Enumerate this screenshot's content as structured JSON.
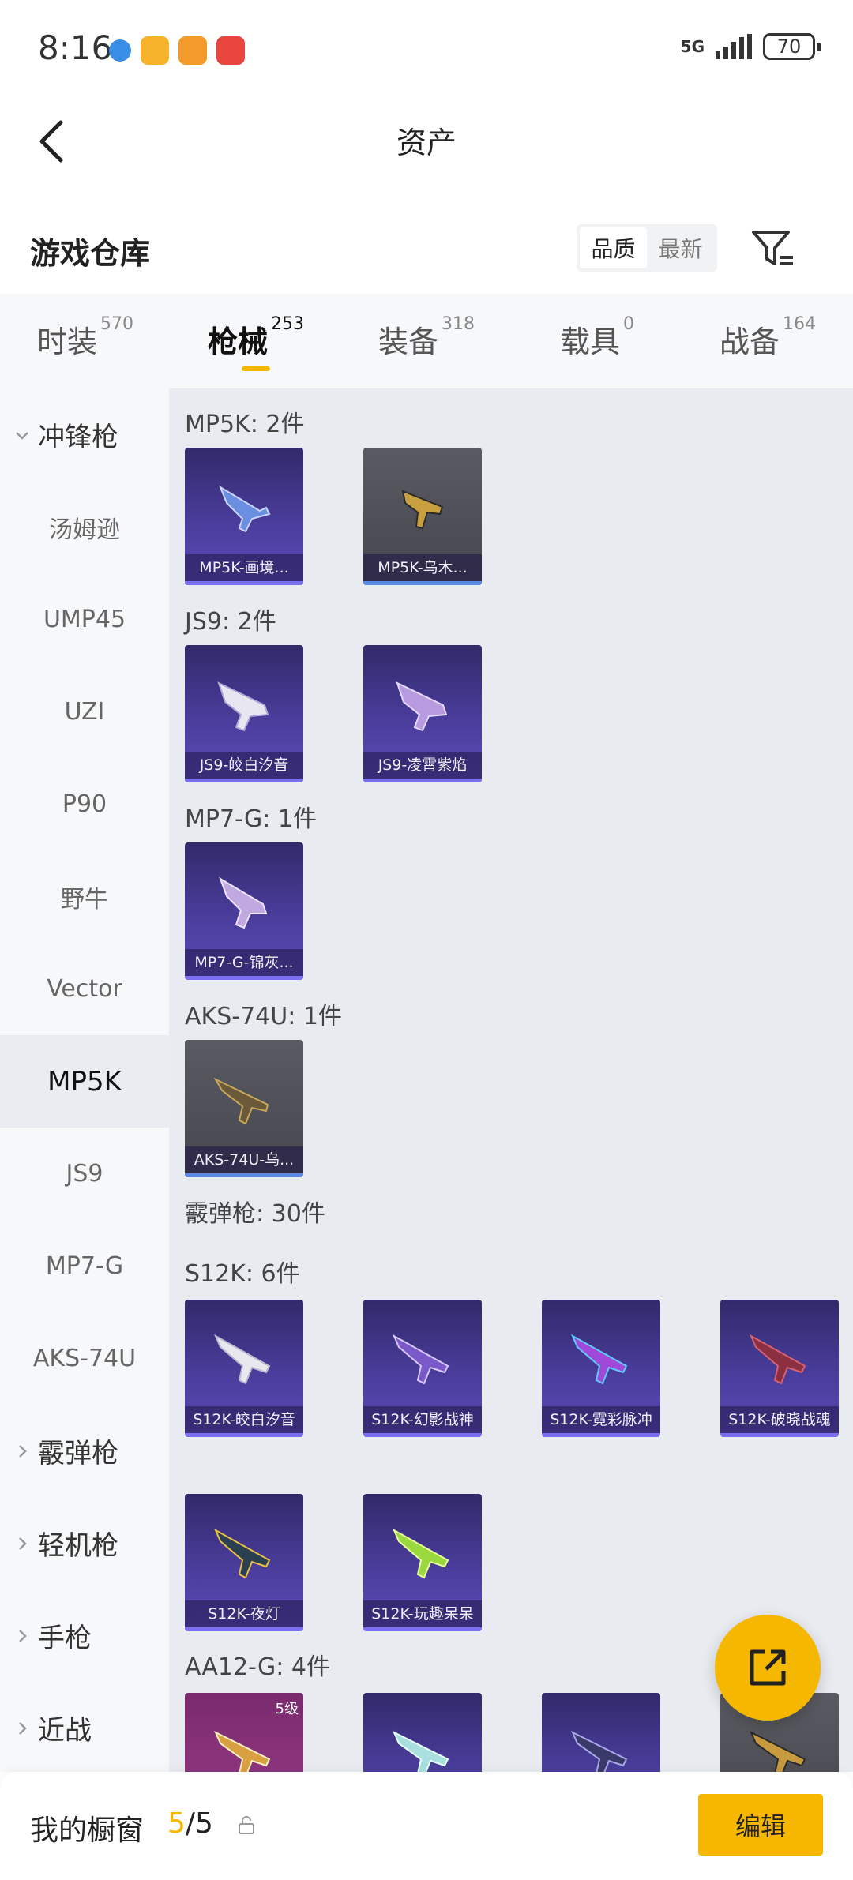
{
  "status": {
    "time": "8:16",
    "network": "5G",
    "battery": "70"
  },
  "header": {
    "title": "资产"
  },
  "warehouse": {
    "title": "游戏仓库",
    "sort_options": [
      "品质",
      "最新"
    ]
  },
  "tabs": [
    {
      "label": "时装",
      "count": "570"
    },
    {
      "label": "枪械",
      "count": "253"
    },
    {
      "label": "装备",
      "count": "318"
    },
    {
      "label": "载具",
      "count": "0"
    },
    {
      "label": "战备",
      "count": "164"
    }
  ],
  "sidebar": {
    "group_open": "冲锋枪",
    "items": [
      "汤姆逊",
      "UMP45",
      "UZI",
      "P90",
      "野牛",
      "Vector",
      "MP5K",
      "JS9",
      "MP7-G",
      "AKS-74U"
    ],
    "active": "MP5K",
    "groups_closed": [
      "霰弹枪",
      "轻机枪",
      "手枪",
      "近战"
    ]
  },
  "sections": [
    {
      "label": "MP5K: 2件",
      "items": [
        "MP5K-画境...",
        "MP5K-乌木..."
      ]
    },
    {
      "label": "JS9: 2件",
      "items": [
        "JS9-皎白汐音",
        "JS9-凌霄紫焰"
      ]
    },
    {
      "label": "MP7-G: 1件",
      "items": [
        "MP7-G-锦灰..."
      ]
    },
    {
      "label": "AKS-74U: 1件",
      "items": [
        "AKS-74U-乌..."
      ]
    },
    {
      "label": "霰弹枪: 30件"
    },
    {
      "label": "S12K: 6件",
      "items": [
        "S12K-皎白汐音",
        "S12K-幻影战神",
        "S12K-霓彩脉冲",
        "S12K-破晓战魂",
        "S12K-夜灯",
        "S12K-玩趣呆呆"
      ]
    },
    {
      "label": "AA12-G: 4件",
      "level_badge": "5级"
    }
  ],
  "bottom": {
    "label": "我的橱窗",
    "current": "5",
    "total": "/5",
    "edit": "编辑"
  },
  "colors": {
    "accent": "#f5b700",
    "card_purple": "#4a3d9c"
  },
  "icons": [
    "back-arrow-icon",
    "filter-icon",
    "chevron-down-icon",
    "chevron-right-icon",
    "share-icon",
    "lock-icon"
  ]
}
